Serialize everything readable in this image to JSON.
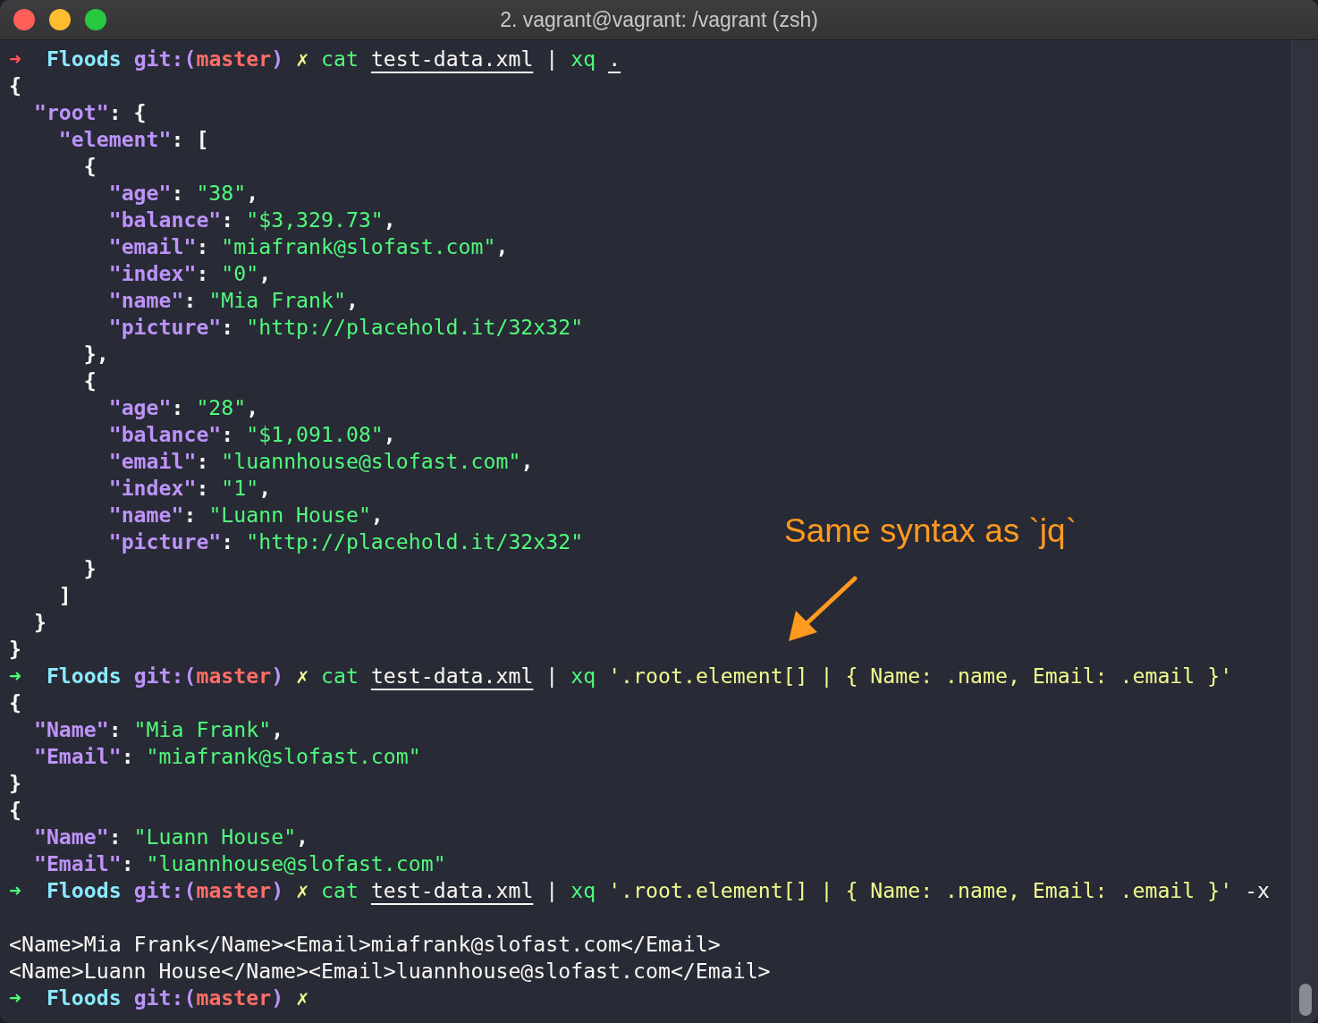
{
  "window": {
    "title": "2. vagrant@vagrant: /vagrant (zsh)"
  },
  "lines": [
    {
      "kind": "text",
      "tokens": [
        {
          "kind": "arrow",
          "ok": false,
          "text": "➜  "
        },
        {
          "kind": "dir",
          "text": "Floods "
        },
        {
          "kind": "git",
          "text": "git:("
        },
        {
          "kind": "branch",
          "text": "master"
        },
        {
          "kind": "git",
          "text": ") "
        },
        {
          "kind": "dirty",
          "text": "✗ "
        },
        {
          "kind": "cmd",
          "text": "cat "
        },
        {
          "kind": "file",
          "text": "test-data.xml"
        },
        {
          "kind": "plain",
          "text": " | "
        },
        {
          "kind": "cmd",
          "text": "xq "
        },
        {
          "kind": "file",
          "text": "."
        }
      ]
    },
    {
      "kind": "text",
      "tokens": [
        {
          "kind": "punct",
          "text": "{"
        }
      ]
    },
    {
      "kind": "text",
      "tokens": [
        {
          "kind": "key",
          "text": "  \"root\""
        },
        {
          "kind": "punct",
          "text": ": {"
        }
      ]
    },
    {
      "kind": "text",
      "tokens": [
        {
          "kind": "key",
          "text": "    \"element\""
        },
        {
          "kind": "punct",
          "text": ": ["
        }
      ]
    },
    {
      "kind": "text",
      "tokens": [
        {
          "kind": "punct",
          "text": "      {"
        }
      ]
    },
    {
      "kind": "text",
      "tokens": [
        {
          "kind": "key",
          "text": "        \"age\""
        },
        {
          "kind": "punct",
          "text": ": "
        },
        {
          "kind": "str",
          "text": "\"38\""
        },
        {
          "kind": "punct",
          "text": ","
        }
      ]
    },
    {
      "kind": "text",
      "tokens": [
        {
          "kind": "key",
          "text": "        \"balance\""
        },
        {
          "kind": "punct",
          "text": ": "
        },
        {
          "kind": "str",
          "text": "\"$3,329.73\""
        },
        {
          "kind": "punct",
          "text": ","
        }
      ]
    },
    {
      "kind": "text",
      "tokens": [
        {
          "kind": "key",
          "text": "        \"email\""
        },
        {
          "kind": "punct",
          "text": ": "
        },
        {
          "kind": "str",
          "text": "\"miafrank@slofast.com\""
        },
        {
          "kind": "punct",
          "text": ","
        }
      ]
    },
    {
      "kind": "text",
      "tokens": [
        {
          "kind": "key",
          "text": "        \"index\""
        },
        {
          "kind": "punct",
          "text": ": "
        },
        {
          "kind": "str",
          "text": "\"0\""
        },
        {
          "kind": "punct",
          "text": ","
        }
      ]
    },
    {
      "kind": "text",
      "tokens": [
        {
          "kind": "key",
          "text": "        \"name\""
        },
        {
          "kind": "punct",
          "text": ": "
        },
        {
          "kind": "str",
          "text": "\"Mia Frank\""
        },
        {
          "kind": "punct",
          "text": ","
        }
      ]
    },
    {
      "kind": "text",
      "tokens": [
        {
          "kind": "key",
          "text": "        \"picture\""
        },
        {
          "kind": "punct",
          "text": ": "
        },
        {
          "kind": "str",
          "text": "\"http://placehold.it/32x32\""
        }
      ]
    },
    {
      "kind": "text",
      "tokens": [
        {
          "kind": "punct",
          "text": "      },"
        }
      ]
    },
    {
      "kind": "text",
      "tokens": [
        {
          "kind": "punct",
          "text": "      {"
        }
      ]
    },
    {
      "kind": "text",
      "tokens": [
        {
          "kind": "key",
          "text": "        \"age\""
        },
        {
          "kind": "punct",
          "text": ": "
        },
        {
          "kind": "str",
          "text": "\"28\""
        },
        {
          "kind": "punct",
          "text": ","
        }
      ]
    },
    {
      "kind": "text",
      "tokens": [
        {
          "kind": "key",
          "text": "        \"balance\""
        },
        {
          "kind": "punct",
          "text": ": "
        },
        {
          "kind": "str",
          "text": "\"$1,091.08\""
        },
        {
          "kind": "punct",
          "text": ","
        }
      ]
    },
    {
      "kind": "text",
      "tokens": [
        {
          "kind": "key",
          "text": "        \"email\""
        },
        {
          "kind": "punct",
          "text": ": "
        },
        {
          "kind": "str",
          "text": "\"luannhouse@slofast.com\""
        },
        {
          "kind": "punct",
          "text": ","
        }
      ]
    },
    {
      "kind": "text",
      "tokens": [
        {
          "kind": "key",
          "text": "        \"index\""
        },
        {
          "kind": "punct",
          "text": ": "
        },
        {
          "kind": "str",
          "text": "\"1\""
        },
        {
          "kind": "punct",
          "text": ","
        }
      ]
    },
    {
      "kind": "text",
      "tokens": [
        {
          "kind": "key",
          "text": "        \"name\""
        },
        {
          "kind": "punct",
          "text": ": "
        },
        {
          "kind": "str",
          "text": "\"Luann House\""
        },
        {
          "kind": "punct",
          "text": ","
        }
      ]
    },
    {
      "kind": "text",
      "tokens": [
        {
          "kind": "key",
          "text": "        \"picture\""
        },
        {
          "kind": "punct",
          "text": ": "
        },
        {
          "kind": "str",
          "text": "\"http://placehold.it/32x32\""
        }
      ]
    },
    {
      "kind": "text",
      "tokens": [
        {
          "kind": "punct",
          "text": "      }"
        }
      ]
    },
    {
      "kind": "text",
      "tokens": [
        {
          "kind": "punct",
          "text": "    ]"
        }
      ]
    },
    {
      "kind": "text",
      "tokens": [
        {
          "kind": "punct",
          "text": "  }"
        }
      ]
    },
    {
      "kind": "text",
      "tokens": [
        {
          "kind": "punct",
          "text": "}"
        }
      ]
    },
    {
      "kind": "text",
      "tokens": [
        {
          "kind": "arrow",
          "ok": true,
          "text": "➜  "
        },
        {
          "kind": "dir",
          "text": "Floods "
        },
        {
          "kind": "git",
          "text": "git:("
        },
        {
          "kind": "branch",
          "text": "master"
        },
        {
          "kind": "git",
          "text": ") "
        },
        {
          "kind": "dirty",
          "text": "✗ "
        },
        {
          "kind": "cmd",
          "text": "cat "
        },
        {
          "kind": "file",
          "text": "test-data.xml"
        },
        {
          "kind": "plain",
          "text": " | "
        },
        {
          "kind": "cmd",
          "text": "xq "
        },
        {
          "kind": "arg",
          "text": "'.root.element[] | { Name: .name, Email: .email }'"
        }
      ]
    },
    {
      "kind": "text",
      "tokens": [
        {
          "kind": "punct",
          "text": "{"
        }
      ]
    },
    {
      "kind": "text",
      "tokens": [
        {
          "kind": "key",
          "text": "  \"Name\""
        },
        {
          "kind": "punct",
          "text": ": "
        },
        {
          "kind": "str",
          "text": "\"Mia Frank\""
        },
        {
          "kind": "punct",
          "text": ","
        }
      ]
    },
    {
      "kind": "text",
      "tokens": [
        {
          "kind": "key",
          "text": "  \"Email\""
        },
        {
          "kind": "punct",
          "text": ": "
        },
        {
          "kind": "str",
          "text": "\"miafrank@slofast.com\""
        }
      ]
    },
    {
      "kind": "text",
      "tokens": [
        {
          "kind": "punct",
          "text": "}"
        }
      ]
    },
    {
      "kind": "text",
      "tokens": [
        {
          "kind": "punct",
          "text": "{"
        }
      ]
    },
    {
      "kind": "text",
      "tokens": [
        {
          "kind": "key",
          "text": "  \"Name\""
        },
        {
          "kind": "punct",
          "text": ": "
        },
        {
          "kind": "str",
          "text": "\"Luann House\""
        },
        {
          "kind": "punct",
          "text": ","
        }
      ]
    },
    {
      "kind": "text",
      "tokens": [
        {
          "kind": "key",
          "text": "  \"Email\""
        },
        {
          "kind": "punct",
          "text": ": "
        },
        {
          "kind": "str",
          "text": "\"luannhouse@slofast.com\""
        }
      ]
    },
    {
      "kind": "text",
      "tokens": [
        {
          "kind": "arrow",
          "ok": true,
          "text": "➜  "
        },
        {
          "kind": "dir",
          "text": "Floods "
        },
        {
          "kind": "git",
          "text": "git:("
        },
        {
          "kind": "branch",
          "text": "master"
        },
        {
          "kind": "git",
          "text": ") "
        },
        {
          "kind": "dirty",
          "text": "✗ "
        },
        {
          "kind": "cmd",
          "text": "cat "
        },
        {
          "kind": "file",
          "text": "test-data.xml"
        },
        {
          "kind": "plain",
          "text": " | "
        },
        {
          "kind": "cmd",
          "text": "xq "
        },
        {
          "kind": "arg",
          "text": "'.root.element[] | { Name: .name, Email: .email }'"
        },
        {
          "kind": "plain",
          "text": " -x"
        }
      ]
    },
    {
      "kind": "blank"
    },
    {
      "kind": "text",
      "tokens": [
        {
          "kind": "plain",
          "text": "<Name>Mia Frank</Name><Email>miafrank@slofast.com</Email>"
        }
      ]
    },
    {
      "kind": "text",
      "tokens": [
        {
          "kind": "plain",
          "text": "<Name>Luann House</Name><Email>luannhouse@slofast.com</Email>"
        }
      ]
    },
    {
      "kind": "text",
      "tokens": [
        {
          "kind": "arrow",
          "ok": true,
          "text": "➜  "
        },
        {
          "kind": "dir",
          "text": "Floods "
        },
        {
          "kind": "git",
          "text": "git:("
        },
        {
          "kind": "branch",
          "text": "master"
        },
        {
          "kind": "git",
          "text": ") "
        },
        {
          "kind": "dirty",
          "text": "✗"
        }
      ]
    }
  ],
  "annotation": {
    "text": "Same syntax as `jq`"
  }
}
